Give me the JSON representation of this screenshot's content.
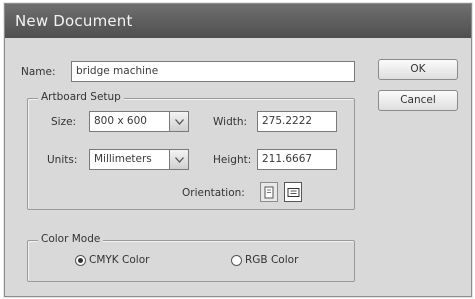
{
  "window": {
    "title": "New Document"
  },
  "name_field": {
    "label": "Name:",
    "value": "bridge machine"
  },
  "artboard": {
    "legend": "Artboard Setup",
    "size_label": "Size:",
    "size_value": "800 x 600",
    "units_label": "Units:",
    "units_value": "Millimeters",
    "width_label": "Width:",
    "width_value": "275.2222",
    "height_label": "Height:",
    "height_value": "211.6667",
    "orientation_label": "Orientation:",
    "orientation_selected": "landscape"
  },
  "color_mode": {
    "legend": "Color Mode",
    "options": [
      {
        "label": "CMYK Color",
        "checked": true
      },
      {
        "label": "RGB Color",
        "checked": false
      }
    ]
  },
  "buttons": {
    "ok": "OK",
    "cancel": "Cancel"
  },
  "icons": {
    "dropdown": "chevron-down-icon",
    "portrait": "portrait-orientation-icon",
    "landscape": "landscape-orientation-icon"
  },
  "colors": {
    "titlebar": "#5e5e5e",
    "dialog_bg": "#d9d9d9",
    "field_bg": "#ffffff"
  }
}
